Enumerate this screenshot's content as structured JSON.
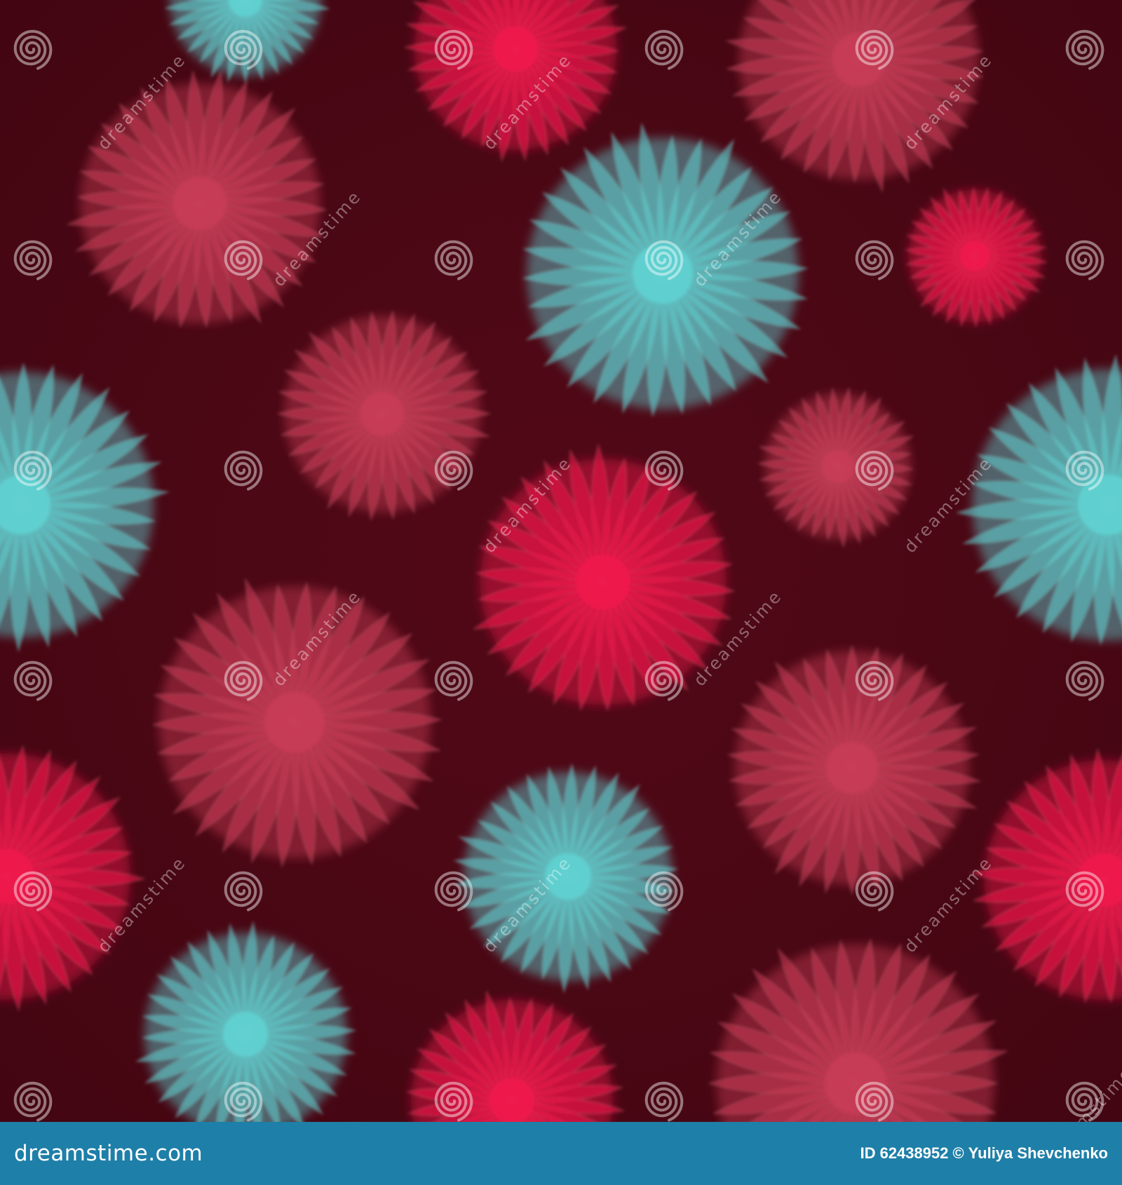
{
  "image": {
    "background_color": "#4c0714",
    "footer_color": "#1e7fa8",
    "flower_colors": {
      "pink": "#f0164b",
      "rose": "#c83c55",
      "teal": "#5fd1d2"
    },
    "watermark_text": "dreamstime",
    "watermark_icon": "spiral-icon"
  },
  "footer": {
    "brand": "dreamstime.com",
    "id_label": "ID",
    "id_value": "62438952",
    "copyright": "©",
    "author": "Yuliya Shevchenko"
  }
}
